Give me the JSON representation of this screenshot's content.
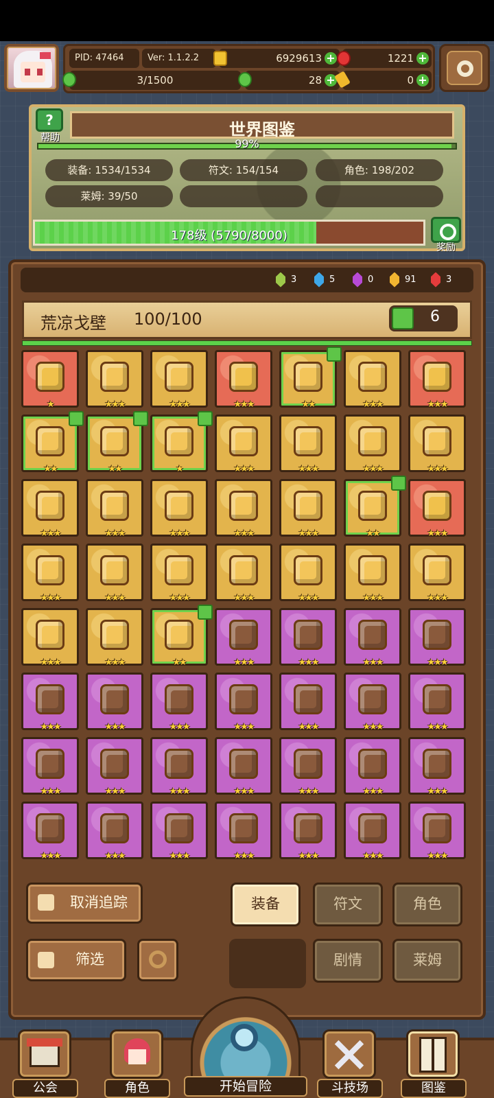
{
  "header": {
    "pid": "PID: 47464",
    "version": "Ver: 1.1.2.2",
    "gold": "6929613",
    "ruby": "1221",
    "stamina": "3/1500",
    "clover": "28",
    "key": "0"
  },
  "codex": {
    "title": "世界图鉴",
    "help_label": "帮助",
    "percent": "99%",
    "percent_value": 0.99,
    "stats": {
      "equipment": "装备: 1534/1534",
      "rune": "符文: 154/154",
      "character": "角色: 198/202",
      "slime": "莱姆: 39/50"
    },
    "level_text": "178级 (5790/8000)",
    "level_progress": 0.724,
    "reward_label": "奖励"
  },
  "gems": [
    {
      "color": "#9dc84a",
      "count": "3"
    },
    {
      "color": "#3ea7e8",
      "count": "5"
    },
    {
      "color": "#b84ad6",
      "count": "0"
    },
    {
      "color": "#f2b531",
      "count": "91"
    },
    {
      "color": "#e53c3c",
      "count": "3"
    }
  ],
  "region": {
    "name": "荒凉戈壁",
    "count": "100/100",
    "likes": "6",
    "progress": 1.0
  },
  "items": [
    {
      "rarity": "red",
      "stars": 1,
      "tracked": false
    },
    {
      "rarity": "gold",
      "stars": 3,
      "tracked": false
    },
    {
      "rarity": "gold",
      "stars": 3,
      "tracked": false
    },
    {
      "rarity": "red",
      "stars": 3,
      "tracked": false
    },
    {
      "rarity": "gold",
      "stars": 2,
      "tracked": true
    },
    {
      "rarity": "gold",
      "stars": 3,
      "tracked": false
    },
    {
      "rarity": "red",
      "stars": 3,
      "tracked": false
    },
    {
      "rarity": "gold",
      "stars": 2,
      "tracked": true
    },
    {
      "rarity": "gold",
      "stars": 2,
      "tracked": true
    },
    {
      "rarity": "gold",
      "stars": 1,
      "tracked": true
    },
    {
      "rarity": "gold",
      "stars": 3,
      "tracked": false
    },
    {
      "rarity": "gold",
      "stars": 3,
      "tracked": false
    },
    {
      "rarity": "gold",
      "stars": 3,
      "tracked": false
    },
    {
      "rarity": "gold",
      "stars": 3,
      "tracked": false
    },
    {
      "rarity": "gold",
      "stars": 3,
      "tracked": false
    },
    {
      "rarity": "gold",
      "stars": 3,
      "tracked": false
    },
    {
      "rarity": "gold",
      "stars": 3,
      "tracked": false
    },
    {
      "rarity": "gold",
      "stars": 3,
      "tracked": false
    },
    {
      "rarity": "gold",
      "stars": 3,
      "tracked": false
    },
    {
      "rarity": "gold",
      "stars": 2,
      "tracked": true
    },
    {
      "rarity": "red",
      "stars": 3,
      "tracked": false
    },
    {
      "rarity": "gold",
      "stars": 3,
      "tracked": false
    },
    {
      "rarity": "gold",
      "stars": 3,
      "tracked": false
    },
    {
      "rarity": "gold",
      "stars": 3,
      "tracked": false
    },
    {
      "rarity": "gold",
      "stars": 3,
      "tracked": false
    },
    {
      "rarity": "gold",
      "stars": 3,
      "tracked": false
    },
    {
      "rarity": "gold",
      "stars": 3,
      "tracked": false
    },
    {
      "rarity": "gold",
      "stars": 3,
      "tracked": false
    },
    {
      "rarity": "gold",
      "stars": 3,
      "tracked": false
    },
    {
      "rarity": "gold",
      "stars": 3,
      "tracked": false
    },
    {
      "rarity": "gold",
      "stars": 2,
      "tracked": true
    },
    {
      "rarity": "purple",
      "stars": 3,
      "tracked": false
    },
    {
      "rarity": "purple",
      "stars": 3,
      "tracked": false
    },
    {
      "rarity": "purple",
      "stars": 3,
      "tracked": false
    },
    {
      "rarity": "purple",
      "stars": 3,
      "tracked": false
    },
    {
      "rarity": "purple",
      "stars": 3,
      "tracked": false
    },
    {
      "rarity": "purple",
      "stars": 3,
      "tracked": false
    },
    {
      "rarity": "purple",
      "stars": 3,
      "tracked": false
    },
    {
      "rarity": "purple",
      "stars": 3,
      "tracked": false
    },
    {
      "rarity": "purple",
      "stars": 3,
      "tracked": false
    },
    {
      "rarity": "purple",
      "stars": 3,
      "tracked": false
    },
    {
      "rarity": "purple",
      "stars": 3,
      "tracked": false
    },
    {
      "rarity": "purple",
      "stars": 3,
      "tracked": false
    },
    {
      "rarity": "purple",
      "stars": 3,
      "tracked": false
    },
    {
      "rarity": "purple",
      "stars": 3,
      "tracked": false
    },
    {
      "rarity": "purple",
      "stars": 3,
      "tracked": false
    },
    {
      "rarity": "purple",
      "stars": 3,
      "tracked": false
    },
    {
      "rarity": "purple",
      "stars": 3,
      "tracked": false
    },
    {
      "rarity": "purple",
      "stars": 3,
      "tracked": false
    },
    {
      "rarity": "purple",
      "stars": 3,
      "tracked": false
    },
    {
      "rarity": "purple",
      "stars": 3,
      "tracked": false
    },
    {
      "rarity": "purple",
      "stars": 3,
      "tracked": false
    },
    {
      "rarity": "purple",
      "stars": 3,
      "tracked": false
    },
    {
      "rarity": "purple",
      "stars": 3,
      "tracked": false
    },
    {
      "rarity": "purple",
      "stars": 3,
      "tracked": false
    },
    {
      "rarity": "purple",
      "stars": 3,
      "tracked": false
    }
  ],
  "controls": {
    "untrack": "取消追踪",
    "filter": "筛选",
    "tab_equipment": "装备",
    "tab_rune": "符文",
    "tab_character": "角色",
    "tab_story": "剧情",
    "tab_slime": "莱姆"
  },
  "nav": {
    "guild": "公会",
    "character": "角色",
    "adventure": "开始冒险",
    "arena": "斗技场",
    "codex": "图鉴"
  }
}
